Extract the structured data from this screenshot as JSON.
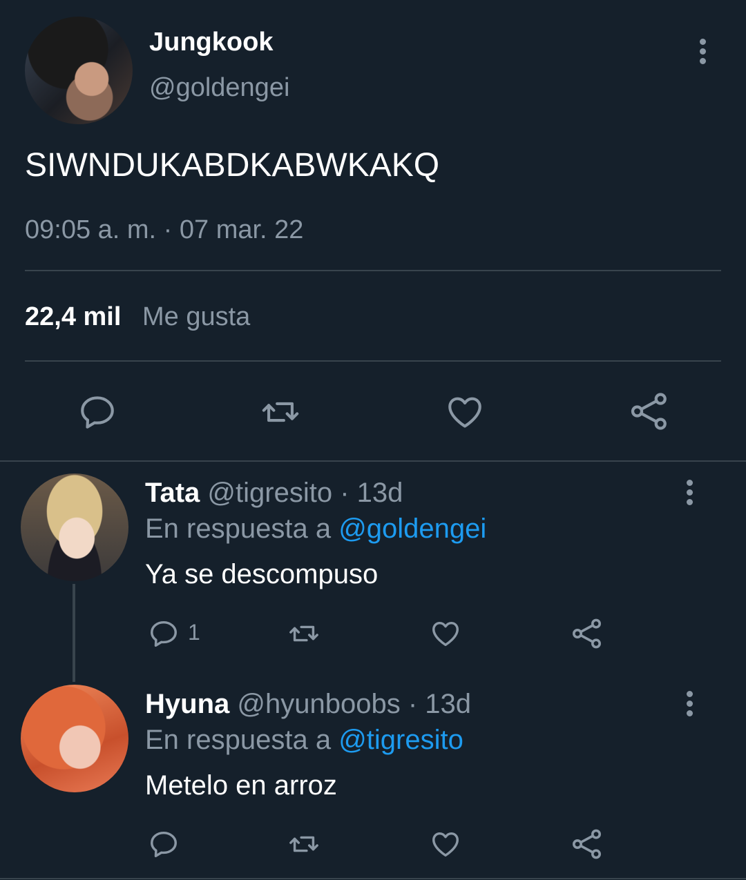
{
  "main_tweet": {
    "display_name": "Jungkook",
    "handle": "@goldengei",
    "text": "SIWNDUKABDKABWKAKQ",
    "timestamp": "09:05 a. m. · 07 mar. 22",
    "likes_count": "22,4 mil",
    "likes_label": "Me gusta"
  },
  "replies": [
    {
      "display_name": "Tata",
      "handle": "@tigresito",
      "age": "· 13d",
      "reply_prefix": "En respuesta a",
      "reply_to": "@goldengei",
      "text": "Ya se descompuso",
      "reply_count": "1"
    },
    {
      "display_name": "Hyuna",
      "handle": "@hyunboobs",
      "age": "· 13d",
      "reply_prefix": "En respuesta a",
      "reply_to": "@tigresito",
      "text": "Metelo en arroz",
      "reply_count": ""
    }
  ],
  "colors": {
    "background": "#15202b",
    "muted": "#8b98a5",
    "link": "#1d9bf0",
    "divider": "#38444d"
  },
  "icons": [
    "reply-icon",
    "retweet-icon",
    "like-icon",
    "share-icon",
    "more-icon"
  ]
}
